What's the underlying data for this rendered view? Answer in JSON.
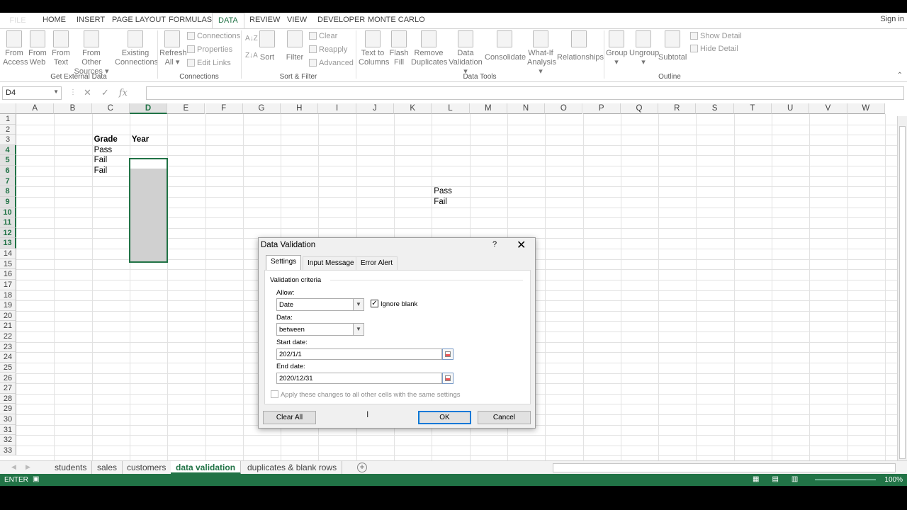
{
  "ribbon_tabs": [
    "FILE",
    "HOME",
    "INSERT",
    "PAGE LAYOUT",
    "FORMULAS",
    "DATA",
    "REVIEW",
    "VIEW",
    "DEVELOPER",
    "MONTE CARLO"
  ],
  "active_tab": "DATA",
  "signin": "Sign in",
  "ribbon": {
    "from_access": [
      "From",
      "Access"
    ],
    "from_web": [
      "From",
      "Web"
    ],
    "from_text": [
      "From",
      "Text"
    ],
    "from_other": [
      "From Other",
      "Sources ▾"
    ],
    "existing": [
      "Existing",
      "Connections"
    ],
    "refresh": [
      "Refresh",
      "All ▾"
    ],
    "connections": "Connections",
    "properties": "Properties",
    "edit_links": "Edit Links",
    "sort": "Sort",
    "filter": "Filter",
    "clear": "Clear",
    "reapply": "Reapply",
    "advanced": "Advanced",
    "text_to_columns": [
      "Text to",
      "Columns"
    ],
    "flash_fill": [
      "Flash",
      "Fill"
    ],
    "remove_dup": [
      "Remove",
      "Duplicates"
    ],
    "data_validation": [
      "Data",
      "Validation ▾"
    ],
    "consolidate": "Consolidate",
    "what_if": [
      "What-If",
      "Analysis ▾"
    ],
    "relationships": "Relationships",
    "group": [
      "Group",
      "▾"
    ],
    "ungroup": [
      "Ungroup",
      "▾"
    ],
    "subtotal": "Subtotal",
    "show_detail": "Show Detail",
    "hide_detail": "Hide Detail",
    "groups": {
      "get_external": "Get External Data",
      "connections": "Connections",
      "sort_filter": "Sort & Filter",
      "data_tools": "Data Tools",
      "outline": "Outline"
    }
  },
  "formula_bar": {
    "name_box": "D4",
    "fx": "fx",
    "formula": ""
  },
  "columns": [
    "A",
    "B",
    "C",
    "D",
    "E",
    "F",
    "G",
    "H",
    "I",
    "J",
    "K",
    "L",
    "M",
    "N",
    "O",
    "P",
    "Q",
    "R",
    "S",
    "T",
    "U",
    "V",
    "W"
  ],
  "rows": [
    "1",
    "2",
    "3",
    "4",
    "5",
    "6",
    "7",
    "8",
    "9",
    "10",
    "11",
    "12",
    "13",
    "14",
    "15",
    "16",
    "17",
    "18",
    "19",
    "20",
    "21",
    "22",
    "23",
    "24",
    "25",
    "26",
    "27",
    "28",
    "29",
    "30",
    "31",
    "32",
    "33"
  ],
  "cells": {
    "C3": "Grade",
    "D3": "Year",
    "C4": "Pass",
    "C5": "Fail",
    "C6": "Fail",
    "L8": "Pass",
    "L9": "Fail"
  },
  "sheet_tabs": [
    "students",
    "sales",
    "customers",
    "data validation",
    "duplicates & blank rows"
  ],
  "active_sheet": "data validation",
  "status": {
    "mode": "ENTER",
    "zoom": "100%"
  },
  "dialog": {
    "title": "Data Validation",
    "help": "?",
    "close": "✕",
    "tabs": [
      "Settings",
      "Input Message",
      "Error Alert"
    ],
    "active_tab": "Settings",
    "group_label": "Validation criteria",
    "allow_label": "Allow:",
    "allow_value": "Date",
    "ignore_blank_label": "Ignore blank",
    "ignore_blank_checked": true,
    "data_label": "Data:",
    "data_value": "between",
    "start_label": "Start date:",
    "start_value": "202/1/1",
    "end_label": "End date:",
    "end_value": "2020/12/31",
    "apply_all_label": "Apply these changes to all other cells with the same settings",
    "apply_all_checked": false,
    "clear_all": "Clear All",
    "ok": "OK",
    "cancel": "Cancel"
  }
}
